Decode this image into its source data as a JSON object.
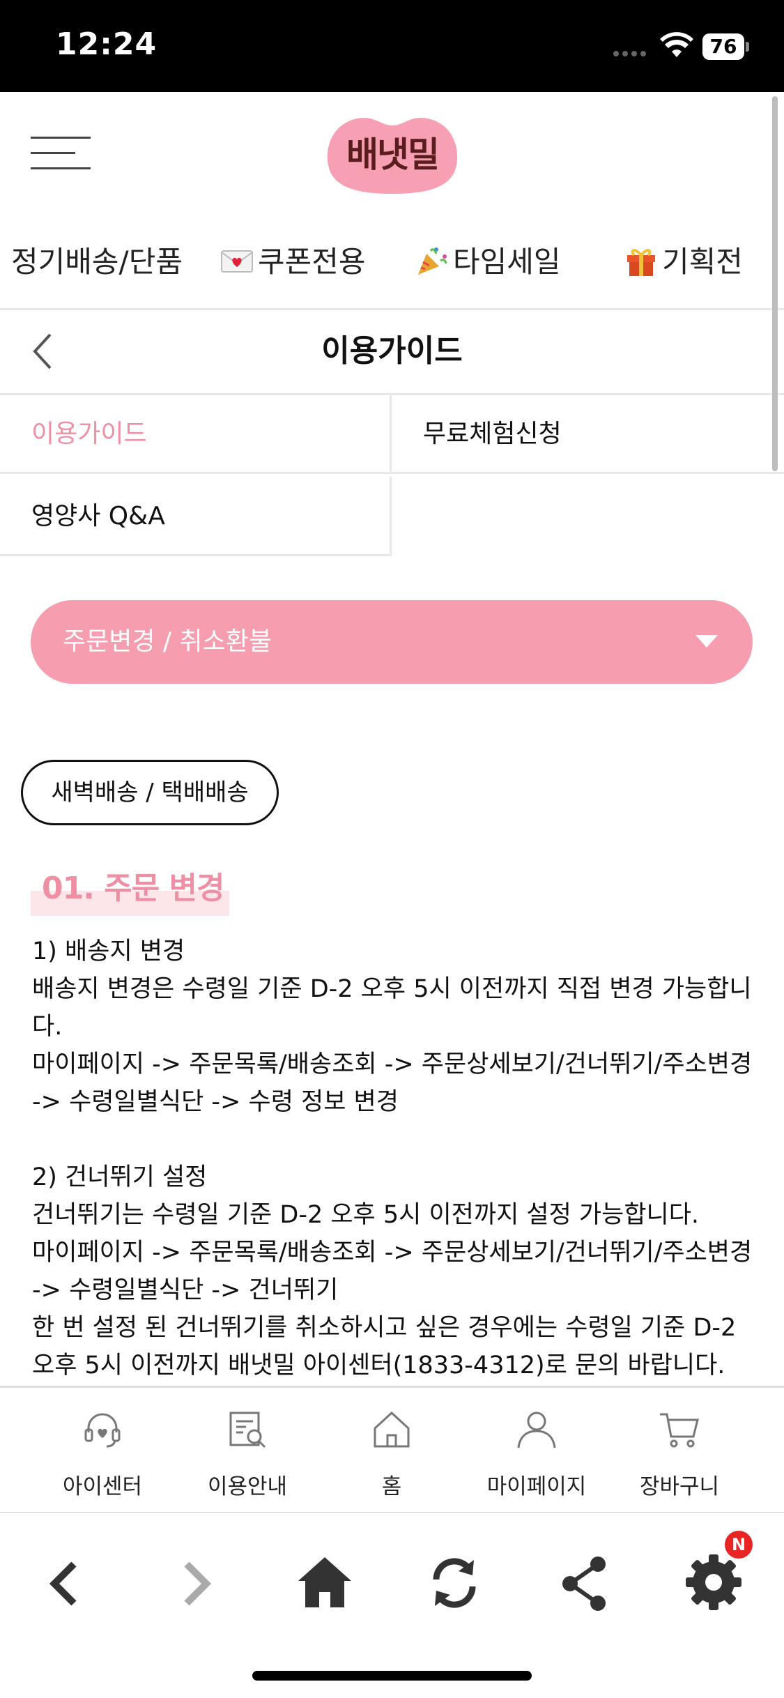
{
  "status_bar": {
    "time": "12:24",
    "battery": "76"
  },
  "header": {
    "logo_text": "배냇밀"
  },
  "categories": [
    {
      "label": "정기배송/단품",
      "icon": ""
    },
    {
      "label": "쿠폰전용",
      "icon": "love-letter-icon"
    },
    {
      "label": "타임세일",
      "icon": "party-popper-icon"
    },
    {
      "label": "기획전",
      "icon": "gift-icon"
    }
  ],
  "page_title": "이용가이드",
  "subnav": {
    "guide": "이용가이드",
    "free_trial": "무료체험신청",
    "nutritionist_qa": "영양사 Q&A"
  },
  "dropdown": {
    "selected": "주문변경 / 취소환불"
  },
  "delivery_tab": "새벽배송 / 택배배송",
  "section": {
    "heading": "01. 주문 변경",
    "paragraphs": [
      "1) 배송지 변경",
      "배송지 변경은 수령일 기준 D-2 오후 5시 이전까지 직접 변경 가능합니다.",
      "마이페이지 -> 주문목록/배송조회 -> 주문상세보기/건너뛰기/주소변경 -> 수령일별식단 -> 수령 정보 변경",
      "",
      "2) 건너뛰기 설정",
      "건너뛰기는 수령일 기준 D-2 오후 5시 이전까지 설정 가능합니다.",
      "마이페이지 -> 주문목록/배송조회 -> 주문상세보기/건너뛰기/주소변경 -> 수령일별식단 -> 건너뛰기",
      "한 번 설정 된 건너뛰기를 취소하시고 싶은 경우에는 수령일 기준 D-2 오후 5시 이전까지 배냇밀 아이센터(1833-4312)로 문의 바랍니다."
    ]
  },
  "app_tabs": [
    {
      "label": "아이센터",
      "icon": "headset-heart-icon"
    },
    {
      "label": "이용안내",
      "icon": "document-search-icon"
    },
    {
      "label": "홈",
      "icon": "house-icon"
    },
    {
      "label": "마이페이지",
      "icon": "person-icon"
    },
    {
      "label": "장바구니",
      "icon": "cart-icon"
    }
  ],
  "browser": {
    "badge": "N"
  },
  "colors": {
    "brand_pink": "#f79db0",
    "accent_pink": "#ef8fa4",
    "logo_text": "#5a1d1d"
  }
}
